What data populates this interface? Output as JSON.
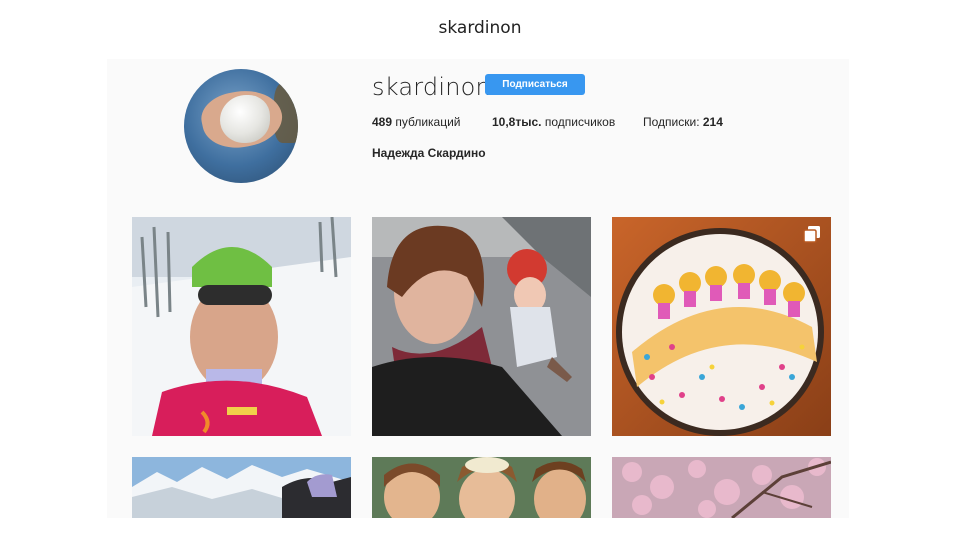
{
  "slide": {
    "title": "skardinon"
  },
  "profile": {
    "username": "skardinon",
    "follow_label": "Подписаться",
    "posts_count": "489",
    "posts_label": "публикаций",
    "followers_count": "10,8тыс.",
    "followers_label": "подписчиков",
    "following_label": "Подписки:",
    "following_count": "214",
    "full_name": "Надежда Скардино"
  },
  "icons": {
    "multi_post": "carousel-icon"
  },
  "colors": {
    "follow_button": "#3897f0",
    "background": "#fafafa",
    "text": "#262626"
  }
}
